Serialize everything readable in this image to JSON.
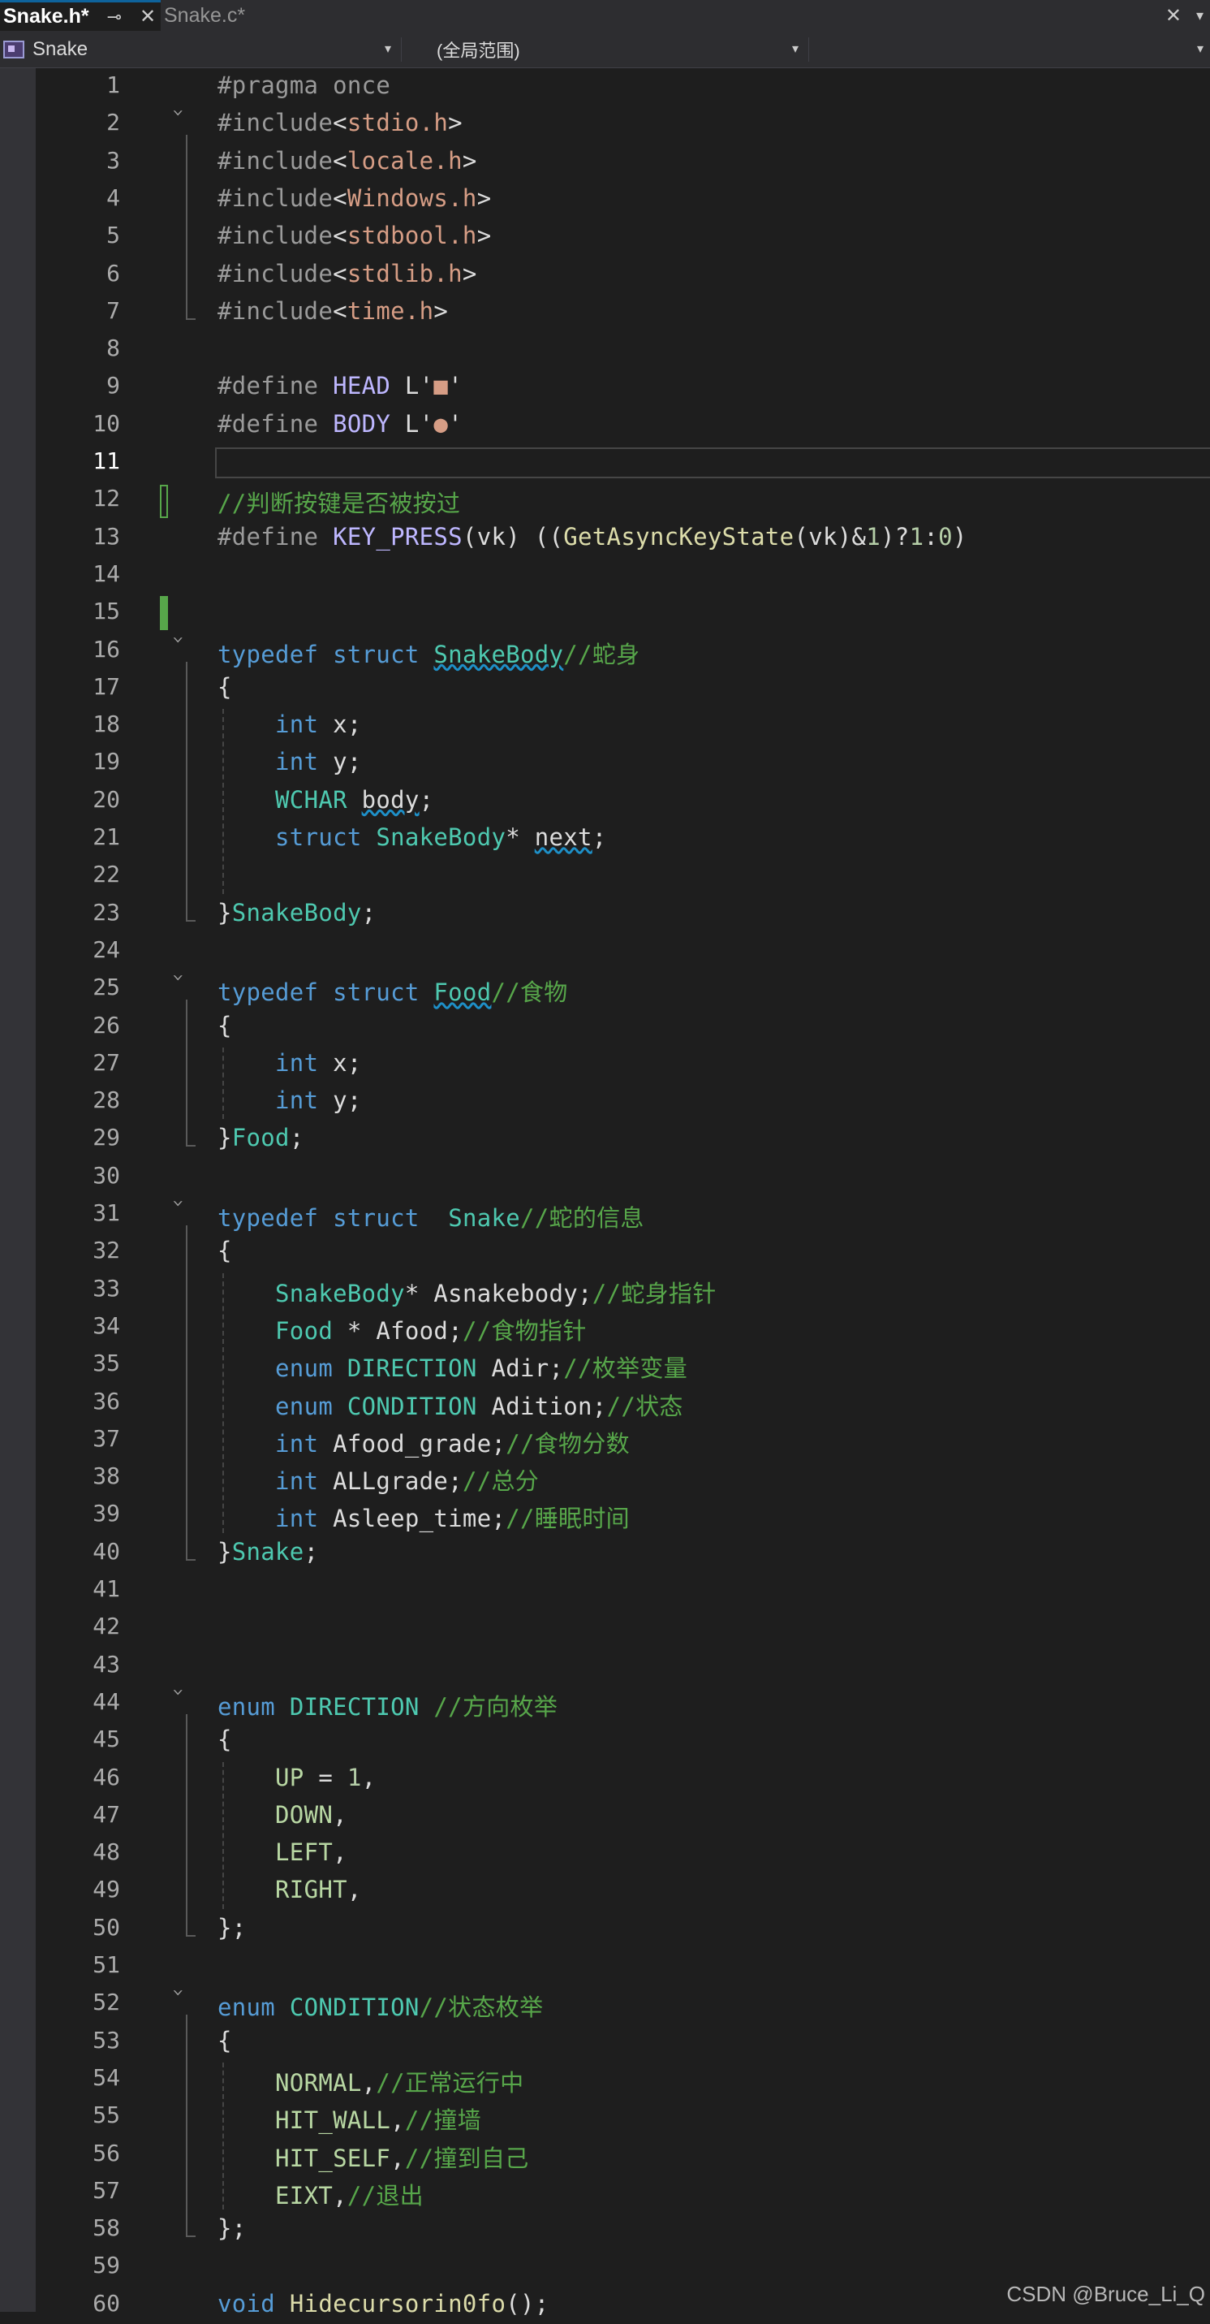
{
  "tabs": [
    {
      "label": "Snake.h*",
      "active": true,
      "pin_icon": "pin-icon",
      "close_icon": "close-icon"
    },
    {
      "label": "Snake.c*",
      "active": false
    }
  ],
  "navbar": {
    "project": "Snake",
    "scope": "(全局范围)",
    "member": ""
  },
  "editor": {
    "current_line": 11,
    "colors": {
      "background": "#1e1e1e",
      "keyword": "#569cd6",
      "type": "#4ec9b0",
      "comment": "#57a64a",
      "string": "#d69d85",
      "macro": "#beb7ff",
      "function": "#dcdcaa",
      "enum_member": "#b8d7a3"
    },
    "lines": [
      {
        "n": "1",
        "t": "#pragma once"
      },
      {
        "n": "2",
        "t": "#include<stdio.h>"
      },
      {
        "n": "3",
        "t": "#include<locale.h>"
      },
      {
        "n": "4",
        "t": "#include<Windows.h>"
      },
      {
        "n": "5",
        "t": "#include<stdbool.h>"
      },
      {
        "n": "6",
        "t": "#include<stdlib.h>"
      },
      {
        "n": "7",
        "t": "#include<time.h>"
      },
      {
        "n": "8",
        "t": ""
      },
      {
        "n": "9",
        "t": "#define HEAD L'■'"
      },
      {
        "n": "10",
        "t": "#define BODY L'●'"
      },
      {
        "n": "11",
        "t": ""
      },
      {
        "n": "12",
        "t": "//判断按键是否被按过"
      },
      {
        "n": "13",
        "t": "#define KEY_PRESS(vk) ((GetAsyncKeyState(vk)&1)?1:0)"
      },
      {
        "n": "14",
        "t": ""
      },
      {
        "n": "15",
        "t": ""
      },
      {
        "n": "16",
        "t": "typedef struct SnakeBody//蛇身"
      },
      {
        "n": "17",
        "t": "{"
      },
      {
        "n": "18",
        "t": "    int x;"
      },
      {
        "n": "19",
        "t": "    int y;"
      },
      {
        "n": "20",
        "t": "    WCHAR body;"
      },
      {
        "n": "21",
        "t": "    struct SnakeBody* next;"
      },
      {
        "n": "22",
        "t": ""
      },
      {
        "n": "23",
        "t": "}SnakeBody;"
      },
      {
        "n": "24",
        "t": ""
      },
      {
        "n": "25",
        "t": "typedef struct Food//食物"
      },
      {
        "n": "26",
        "t": "{"
      },
      {
        "n": "27",
        "t": "    int x;"
      },
      {
        "n": "28",
        "t": "    int y;"
      },
      {
        "n": "29",
        "t": "}Food;"
      },
      {
        "n": "30",
        "t": ""
      },
      {
        "n": "31",
        "t": "typedef struct  Snake//蛇的信息"
      },
      {
        "n": "32",
        "t": "{"
      },
      {
        "n": "33",
        "t": "    SnakeBody* Asnakebody;//蛇身指针"
      },
      {
        "n": "34",
        "t": "    Food * Afood;//食物指针"
      },
      {
        "n": "35",
        "t": "    enum DIRECTION Adir;//枚举变量"
      },
      {
        "n": "36",
        "t": "    enum CONDITION Adition;//状态"
      },
      {
        "n": "37",
        "t": "    int Afood_grade;//食物分数"
      },
      {
        "n": "38",
        "t": "    int ALLgrade;//总分"
      },
      {
        "n": "39",
        "t": "    int Asleep_time;//睡眠时间"
      },
      {
        "n": "40",
        "t": "}Snake;"
      },
      {
        "n": "41",
        "t": ""
      },
      {
        "n": "42",
        "t": ""
      },
      {
        "n": "43",
        "t": ""
      },
      {
        "n": "44",
        "t": "enum DIRECTION //方向枚举"
      },
      {
        "n": "45",
        "t": "{"
      },
      {
        "n": "46",
        "t": "    UP = 1,"
      },
      {
        "n": "47",
        "t": "    DOWN,"
      },
      {
        "n": "48",
        "t": "    LEFT,"
      },
      {
        "n": "49",
        "t": "    RIGHT,"
      },
      {
        "n": "50",
        "t": "};"
      },
      {
        "n": "51",
        "t": ""
      },
      {
        "n": "52",
        "t": "enum CONDITION//状态枚举"
      },
      {
        "n": "53",
        "t": "{"
      },
      {
        "n": "54",
        "t": "    NORMAL,//正常运行中"
      },
      {
        "n": "55",
        "t": "    HIT_WALL,//撞墙"
      },
      {
        "n": "56",
        "t": "    HIT_SELF,//撞到自己"
      },
      {
        "n": "57",
        "t": "    EIXT,//退出"
      },
      {
        "n": "58",
        "t": "};"
      },
      {
        "n": "59",
        "t": ""
      },
      {
        "n": "60",
        "t": "void Hidecursorin0fo();"
      }
    ]
  },
  "watermark": "CSDN @Bruce_Li_Q"
}
